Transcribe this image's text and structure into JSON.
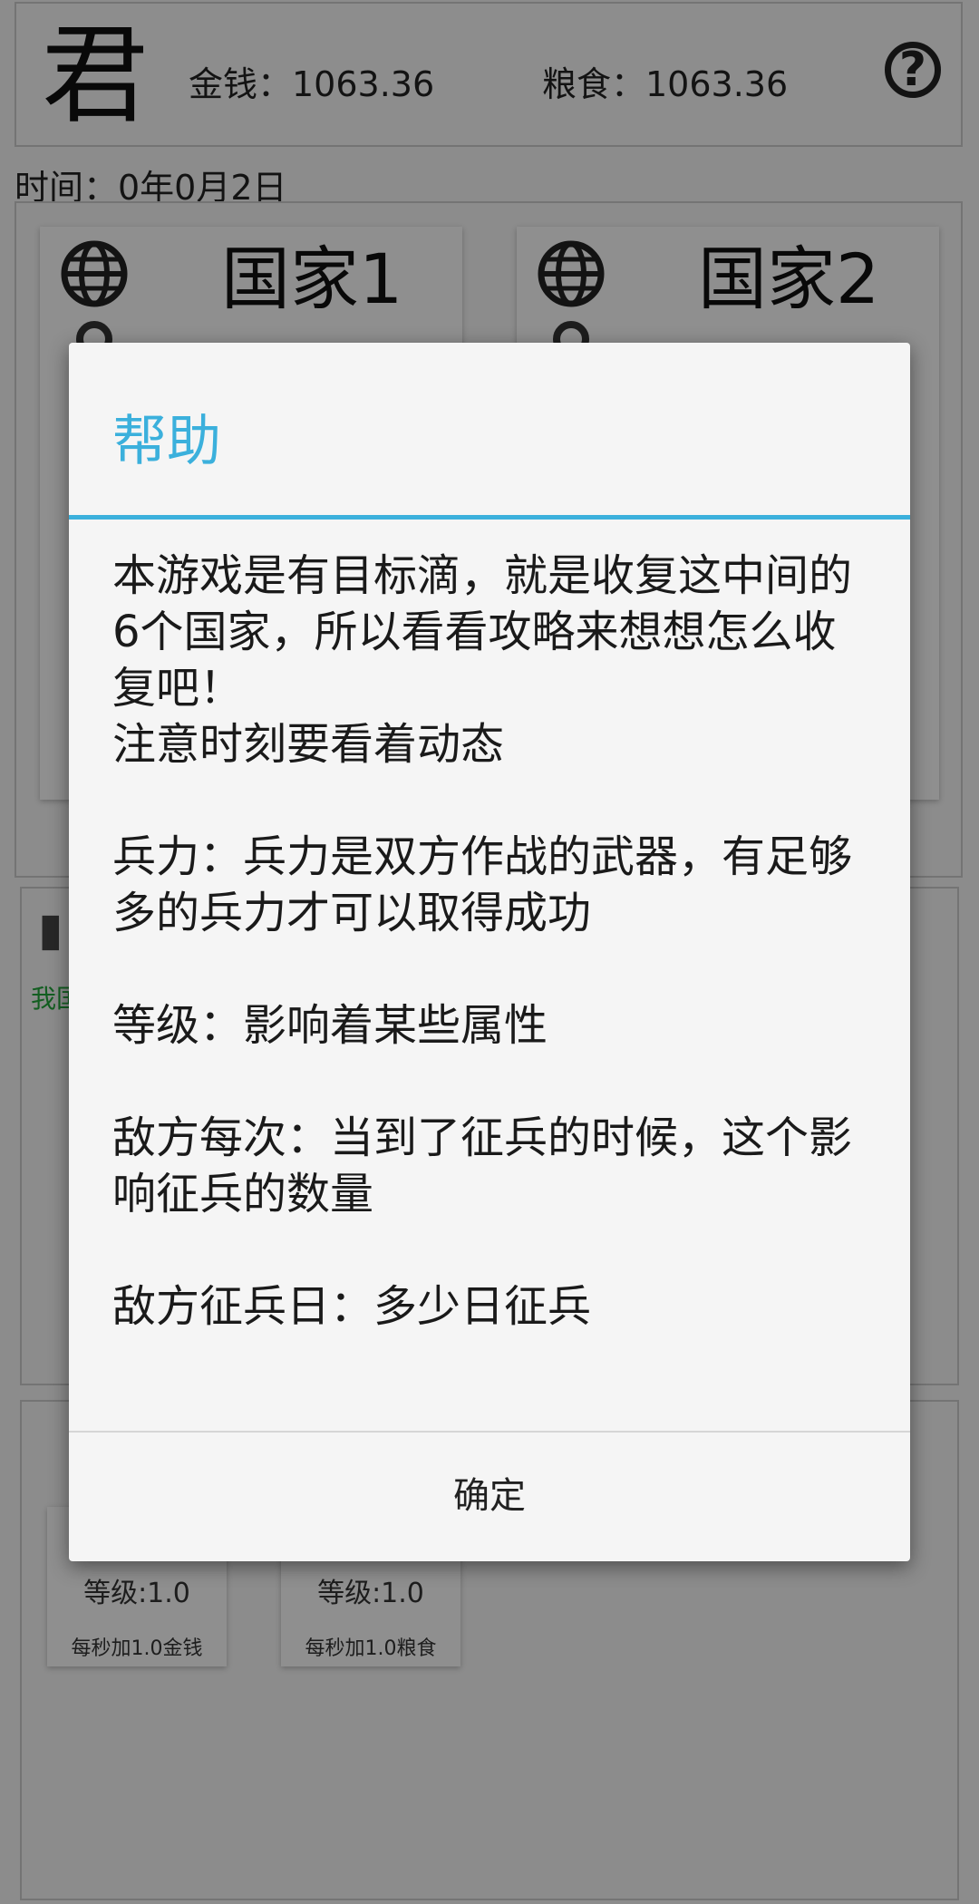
{
  "header": {
    "logo": "君",
    "money": "金钱：1063.36",
    "grain": "粮食：1063.36",
    "help_icon": "question-circle-icon",
    "help_glyph": "?"
  },
  "time": "时间：0年0月2日",
  "countries": [
    {
      "name": "国家1"
    },
    {
      "name": "国家2"
    }
  ],
  "panel2": {
    "my_label": "我国"
  },
  "buildings": [
    {
      "level": "等级:1.0",
      "rate": "每秒加1.0金钱"
    },
    {
      "level": "等级:1.0",
      "rate": "每秒加1.0粮食"
    }
  ],
  "dialog": {
    "title": "帮助",
    "paragraphs": [
      "本游戏是有目标滴，就是收复这中间的6个国家，所以看看攻略来想想怎么收复吧！\n注意时刻要看着动态",
      "兵力：兵力是双方作战的武器，有足够多的兵力才可以取得成功",
      "等级：影响着某些属性",
      "敌方每次：当到了征兵的时候，这个影响征兵的数量",
      "敌方征兵日：多少日征兵"
    ],
    "ok_label": "确定"
  },
  "colors": {
    "accent": "#3bb0dc",
    "green": "#22a33a"
  }
}
